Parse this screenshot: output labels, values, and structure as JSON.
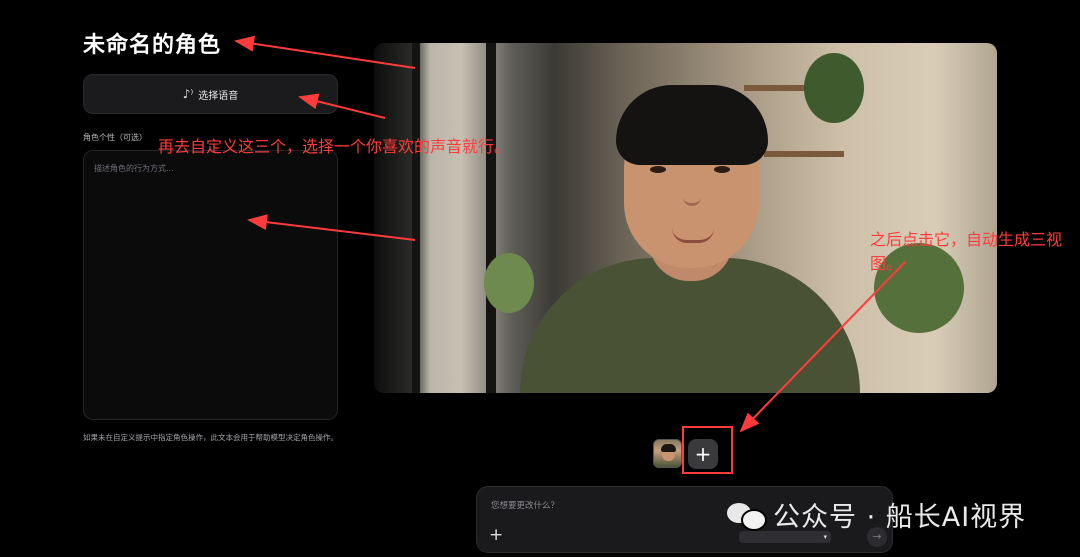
{
  "header": {
    "title": "未命名的角色"
  },
  "voice": {
    "label": "选择语音",
    "icon": "voice-wave-icon"
  },
  "persona": {
    "label": "角色个性（可选）",
    "placeholder": "描述角色的行为方式..."
  },
  "hint": "如果未在自定义提示中指定角色操作，此文本会用于帮助模型决定角色操作。",
  "annotations": {
    "customize": "再去自定义这三个，选择一个你喜欢的声音就行。",
    "click_plus": "之后点击它，自动生成三视图。"
  },
  "toolbar": {
    "add_label": "+"
  },
  "prompt": {
    "placeholder": "您想要更改什么？",
    "add_label": "+",
    "send_label": "→",
    "model_caret": "▾"
  },
  "watermark": {
    "text": "公众号 · 船长AI视界"
  },
  "colors": {
    "accent_annotation": "#ff3b3b",
    "background": "#000000",
    "panel": "#1b1b1d"
  }
}
